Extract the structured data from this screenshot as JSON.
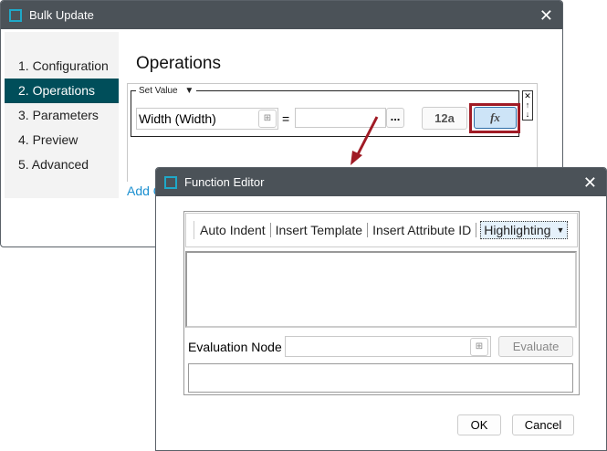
{
  "bulk_update": {
    "title": "Bulk Update",
    "steps": [
      {
        "label": "1. Configuration"
      },
      {
        "label": "2. Operations"
      },
      {
        "label": "3. Parameters"
      },
      {
        "label": "4. Preview"
      },
      {
        "label": "5. Advanced"
      }
    ],
    "heading": "Operations",
    "group_label": "Set Value",
    "attribute_value": "Width (Width)",
    "equals": "=",
    "value_input": "",
    "ellipsis": "...",
    "literal_button": "12a",
    "function_button": "fx",
    "add_link": "Add O"
  },
  "function_editor": {
    "title": "Function Editor",
    "toolbar": {
      "auto_indent": "Auto Indent",
      "insert_template": "Insert Template",
      "insert_attribute_id": "Insert Attribute ID",
      "highlighting": "Highlighting"
    },
    "editor_text": "",
    "evaluation_node_label": "Evaluation Node",
    "evaluation_node_value": "",
    "evaluate": "Evaluate",
    "result_text": "",
    "ok": "OK",
    "cancel": "Cancel"
  },
  "colors": {
    "accent": "#004e5a",
    "highlight": "#a01b25",
    "titlebar": "#4b5258"
  }
}
